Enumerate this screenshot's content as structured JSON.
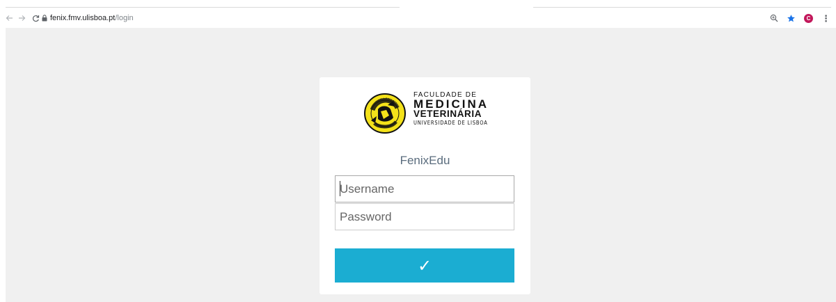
{
  "browser": {
    "url_host": "fenix.fmv.ulisboa.pt",
    "url_path": "/login",
    "profile_initial": "C",
    "profile_color": "#c2185b",
    "icons": [
      "back-arrow-icon",
      "forward-arrow-icon",
      "reload-icon",
      "lock-icon",
      "zoom-icon",
      "bookmark-star-icon",
      "kebab-menu-icon"
    ]
  },
  "logo": {
    "line1": "FACULDADE DE",
    "line2": "MEDICINA",
    "line3": "VETERINÁRIA",
    "line4": "UNIVERSIDADE DE LISBOA",
    "seal_text": "FACULDADE DE MEDICINA VETERINÁRIA"
  },
  "login": {
    "app_name": "FenixEdu",
    "username_placeholder": "Username",
    "password_placeholder": "Password",
    "submit_symbol": "✓"
  },
  "colors": {
    "accent": "#1badd2",
    "page_background": "#f0f0f0",
    "app_name": "#5a6c7d"
  }
}
